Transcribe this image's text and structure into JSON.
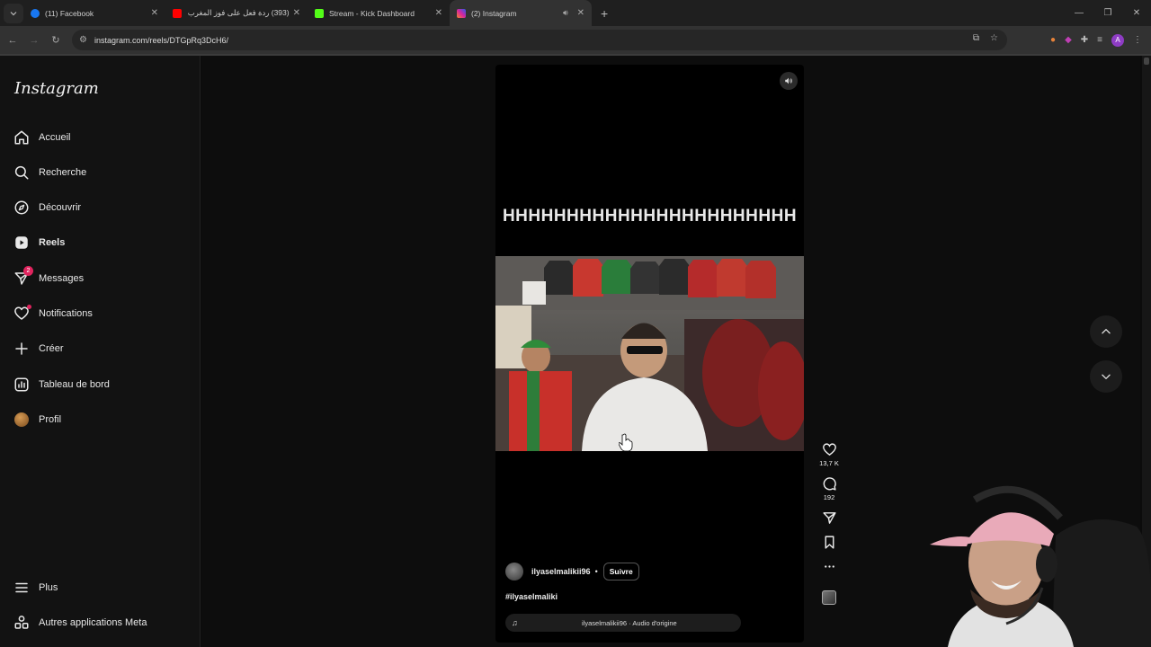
{
  "browser": {
    "tabs": [
      {
        "title": "(11) Facebook",
        "favicon_color": "#1877f2",
        "active": false
      },
      {
        "title": "(393) ردة فعل على فوز المغرب",
        "favicon_color": "#ff0000",
        "active": false
      },
      {
        "title": "Stream - Kick Dashboard",
        "favicon_color": "#53fc18",
        "active": false
      },
      {
        "title": "(2) Instagram",
        "favicon_color": "#d6249f",
        "active": true
      }
    ],
    "url": "instagram.com/reels/DTGpRq3DcH6/",
    "profile_initial": "A"
  },
  "sidebar": {
    "logo": "Instagram",
    "items": [
      {
        "label": "Accueil",
        "icon": "home-icon"
      },
      {
        "label": "Recherche",
        "icon": "search-icon"
      },
      {
        "label": "Découvrir",
        "icon": "compass-icon"
      },
      {
        "label": "Reels",
        "icon": "reels-icon"
      },
      {
        "label": "Messages",
        "icon": "messages-icon",
        "badge": "2"
      },
      {
        "label": "Notifications",
        "icon": "heart-icon"
      },
      {
        "label": "Créer",
        "icon": "plus-icon"
      },
      {
        "label": "Tableau de bord",
        "icon": "dashboard-icon"
      },
      {
        "label": "Profil",
        "icon": "profile-avatar"
      }
    ],
    "bottom": [
      {
        "label": "Plus",
        "icon": "menu-icon"
      },
      {
        "label": "Autres applications Meta",
        "icon": "meta-apps-icon"
      }
    ]
  },
  "reel": {
    "overlay_text": "HHHHHHHHHHHHHHHHHHHHHHH",
    "username": "ilyaselmalikii96",
    "separator": "•",
    "follow_label": "Suivre",
    "hashtag": "#ilyaselmaliki",
    "audio": "ilyaselmalikii96 · Audio d'origine",
    "likes": "13,7 K",
    "comments": "192"
  }
}
